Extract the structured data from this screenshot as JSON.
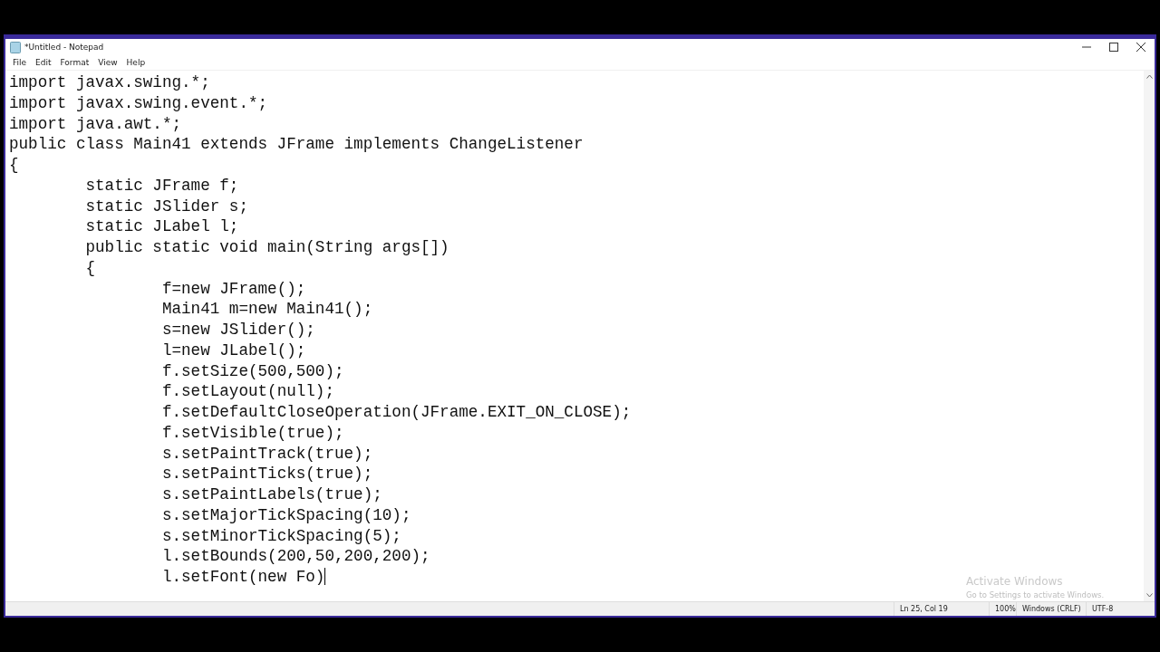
{
  "window": {
    "title": "*Untitled - Notepad"
  },
  "menu": [
    {
      "label": "File"
    },
    {
      "label": "Edit"
    },
    {
      "label": "Format"
    },
    {
      "label": "View"
    },
    {
      "label": "Help"
    }
  ],
  "editor": {
    "lines": [
      "import javax.swing.*;",
      "import javax.swing.event.*;",
      "import java.awt.*;",
      "public class Main41 extends JFrame implements ChangeListener",
      "{",
      "\tstatic JFrame f;",
      "\tstatic JSlider s;",
      "\tstatic JLabel l;",
      "\tpublic static void main(String args[])",
      "\t{",
      "\t\tf=new JFrame();",
      "\t\tMain41 m=new Main41();",
      "\t\ts=new JSlider();",
      "\t\tl=new JLabel();",
      "\t\tf.setSize(500,500);",
      "\t\tf.setLayout(null);",
      "\t\tf.setDefaultCloseOperation(JFrame.EXIT_ON_CLOSE);",
      "\t\tf.setVisible(true);",
      "\t\ts.setPaintTrack(true);",
      "\t\ts.setPaintTicks(true);",
      "\t\ts.setPaintLabels(true);",
      "\t\ts.setMajorTickSpacing(10);",
      "\t\ts.setMinorTickSpacing(5);",
      "\t\tl.setBounds(200,50,200,200);",
      "\t\tl.setFont(new Fo)"
    ]
  },
  "activation": {
    "title": "Activate Windows",
    "subtitle": "Go to Settings to activate Windows."
  },
  "status_bar": {
    "position": "Ln 25, Col 19",
    "zoom": "100%",
    "line_ending": "Windows (CRLF)",
    "encoding": "UTF-8"
  }
}
